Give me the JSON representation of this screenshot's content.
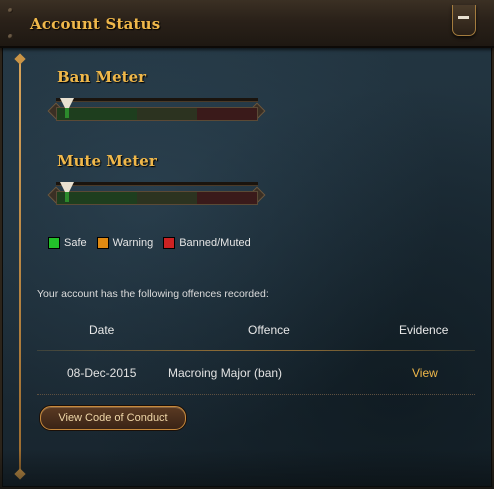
{
  "panel": {
    "title": "Account Status"
  },
  "ban_meter": {
    "title": "Ban Meter",
    "level": 0,
    "segments": [
      {
        "status": "safe",
        "color": "#1e3e1e"
      },
      {
        "status": "warning",
        "color": "#2c3320"
      },
      {
        "status": "banned",
        "color": "#3a1a1a"
      }
    ]
  },
  "mute_meter": {
    "title": "Mute Meter",
    "level": 0,
    "segments": [
      {
        "status": "safe",
        "color": "#1e3e1e"
      },
      {
        "status": "warning",
        "color": "#2c3320"
      },
      {
        "status": "banned",
        "color": "#3a1a1a"
      }
    ]
  },
  "legend": {
    "safe": {
      "label": "Safe",
      "color": "#22c12a"
    },
    "warning": {
      "label": "Warning",
      "color": "#e08a12"
    },
    "banned": {
      "label": "Banned/Muted",
      "color": "#cc2222"
    }
  },
  "offences": {
    "intro": "Your account has the following offences recorded:",
    "columns": [
      "Date",
      "Offence",
      "Evidence"
    ],
    "rows": [
      {
        "date": "08-Dec-2015",
        "offence": "Macroing Major (ban)",
        "evidence": "View"
      }
    ]
  },
  "code_of_conduct_button": "View Code of Conduct",
  "colors": {
    "accent": "#f0b84a",
    "background": "#1f2f3a"
  }
}
